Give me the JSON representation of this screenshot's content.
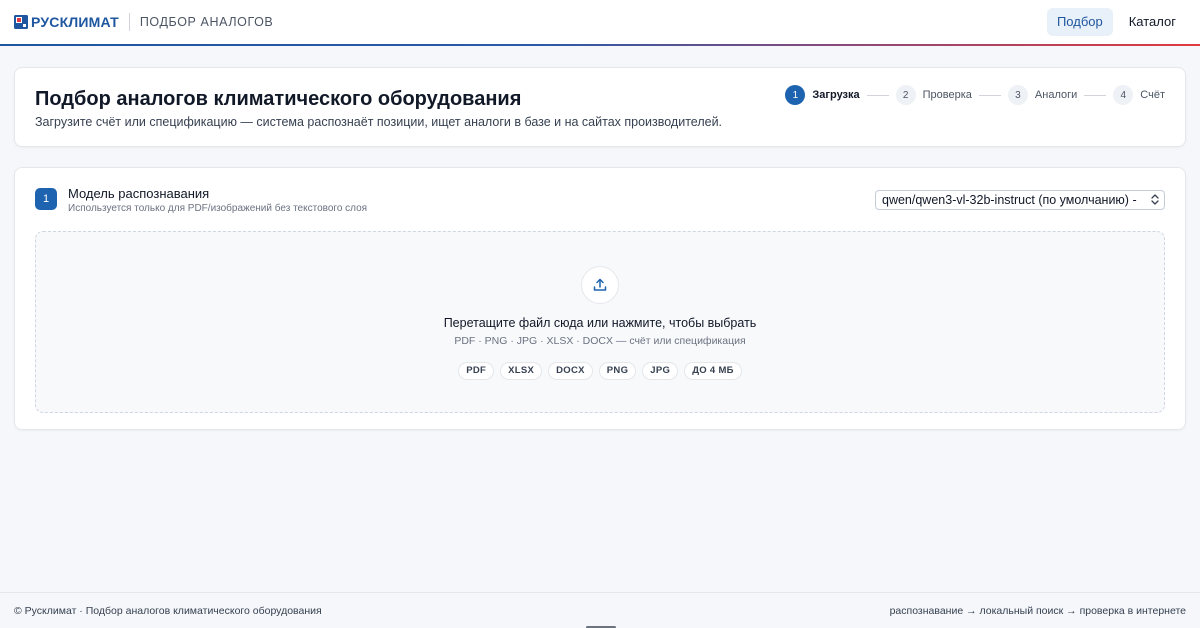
{
  "header": {
    "logo_text": "РУСКЛИМАТ",
    "app_title": "ПОДБОР АНАЛОГОВ",
    "nav": [
      {
        "label": "Подбор",
        "active": true
      },
      {
        "label": "Каталог",
        "active": false
      }
    ]
  },
  "intro": {
    "title": "Подбор аналогов климатического оборудования",
    "subtitle": "Загрузите счёт или спецификацию — система распознаёт позиции, ищет аналоги в базе и на сайтах производителей."
  },
  "stepper": [
    {
      "num": "1",
      "label": "Загрузка",
      "active": true
    },
    {
      "num": "2",
      "label": "Проверка",
      "active": false
    },
    {
      "num": "3",
      "label": "Аналоги",
      "active": false
    },
    {
      "num": "4",
      "label": "Счёт",
      "active": false
    }
  ],
  "model": {
    "badge": "1",
    "title": "Модель распознавания",
    "hint": "Используется только для PDF/изображений без текстового слоя",
    "selected": "qwen/qwen3-vl-32b-instruct (по умолчанию) - "
  },
  "dropzone": {
    "icon": "upload-icon",
    "title": "Перетащите файл сюда или нажмите, чтобы выбрать",
    "subtitle": "PDF · PNG · JPG · XLSX · DOCX — счёт или спецификация",
    "chips": [
      "PDF",
      "XLSX",
      "DOCX",
      "PNG",
      "JPG",
      "ДО 4 МБ"
    ]
  },
  "footer": {
    "left": "© Русклимат · Подбор аналогов климатического оборудования",
    "right": "распознавание → локальный поиск → проверка в интернете"
  },
  "colors": {
    "brand_blue": "#1e56a0",
    "accent_blue": "#1e63b0",
    "brand_red": "#e03a3e",
    "background": "#f5f7fa"
  }
}
